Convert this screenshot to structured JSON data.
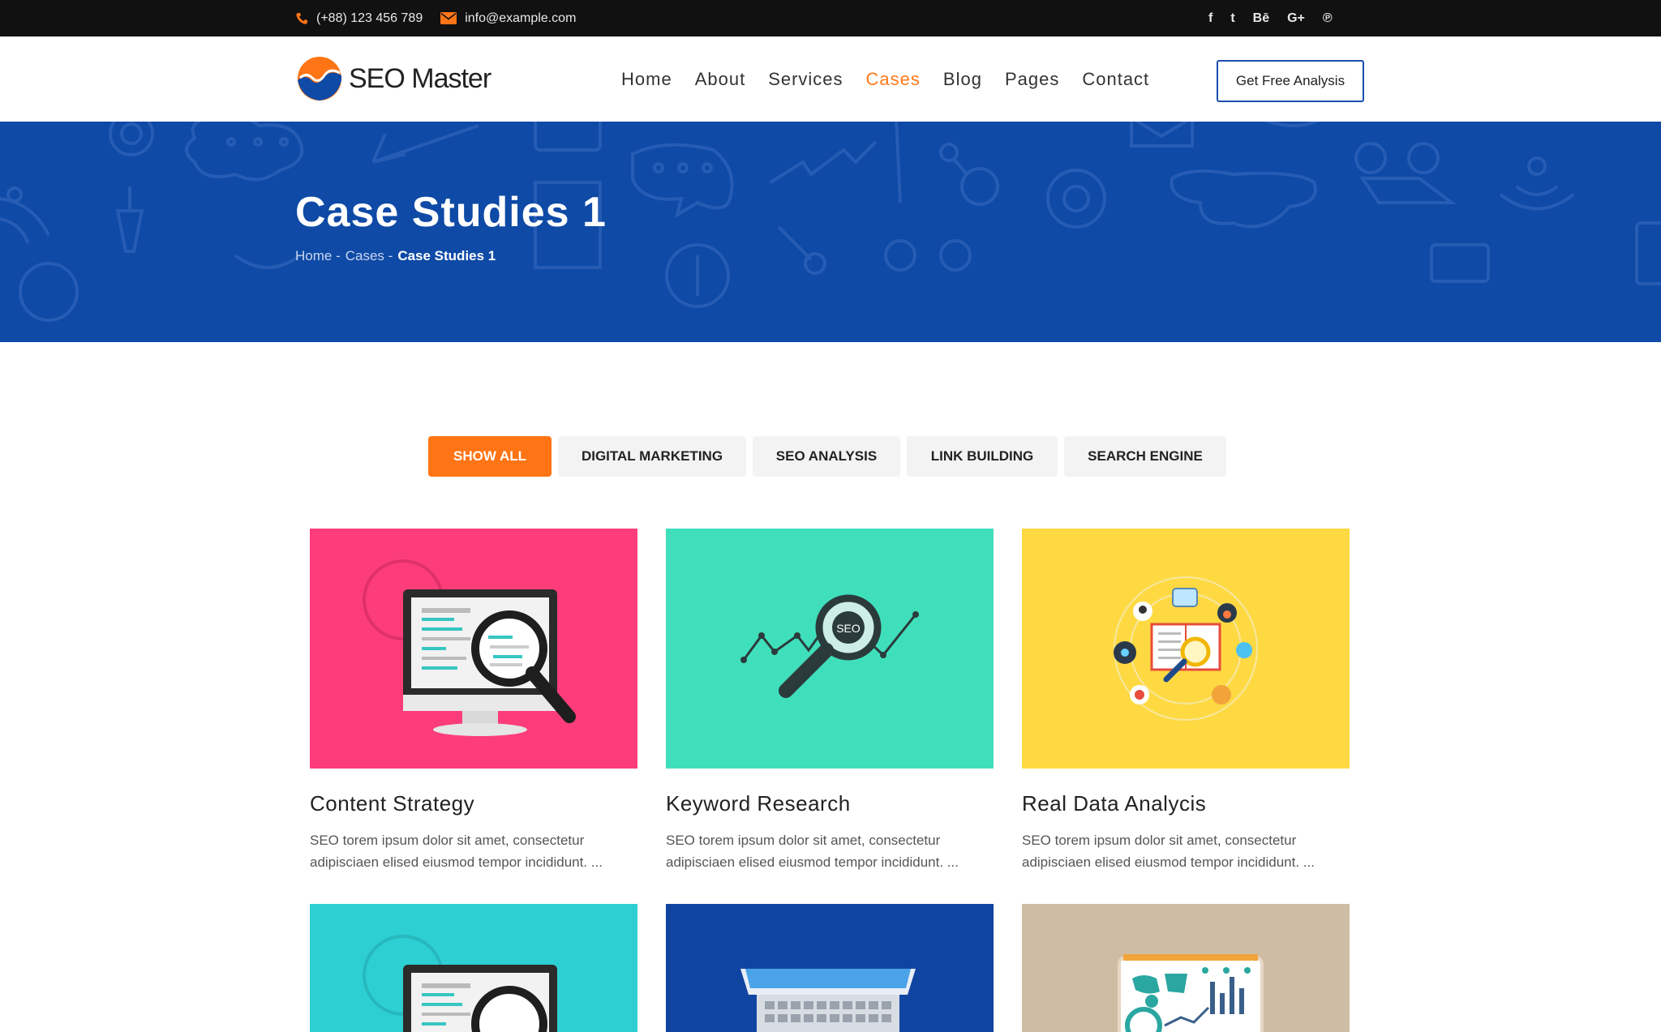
{
  "topbar": {
    "phone": "(+88) 123 456 789",
    "email": "info@example.com",
    "social": [
      {
        "icon": "facebook-icon",
        "glyph": "f"
      },
      {
        "icon": "twitter-icon",
        "glyph": "t"
      },
      {
        "icon": "behance-icon",
        "glyph": "Bē"
      },
      {
        "icon": "google-plus-icon",
        "glyph": "G+"
      },
      {
        "icon": "pinterest-icon",
        "glyph": "℗"
      }
    ]
  },
  "header": {
    "brand": "SEO Master",
    "nav": [
      "Home",
      "About",
      "Services",
      "Cases",
      "Blog",
      "Pages",
      "Contact"
    ],
    "active_nav": "Cases",
    "cta": "Get Free Analysis"
  },
  "hero": {
    "title": "Case Studies 1",
    "breadcrumb": [
      "Home -",
      "Cases -",
      "Case Studies 1"
    ]
  },
  "filters": [
    "Show All",
    "Digital Marketing",
    "SEO Analysis",
    "Link Building",
    "Search Engine"
  ],
  "active_filter": "Show All",
  "cards": [
    {
      "title": "Content Strategy",
      "desc_line1": "SEO torem ipsum dolor sit amet, consectetur",
      "desc_line2": "adipisciaen elised eiusmod tempor incididunt. ...",
      "bg": "#fc3d7a"
    },
    {
      "title": "Keyword Research",
      "desc_line1": "SEO torem ipsum dolor sit amet, consectetur",
      "desc_line2": "adipisciaen elised eiusmod tempor incididunt. ...",
      "bg": "#40dfbc",
      "badge": "SEO"
    },
    {
      "title": "Real Data Analycis",
      "desc_line1": "SEO torem ipsum dolor sit amet, consectetur",
      "desc_line2": "adipisciaen elised eiusmod tempor incididunt. ...",
      "bg": "#fed942"
    },
    {
      "bg": "#2ecfd3"
    },
    {
      "bg": "#0f45a0"
    },
    {
      "bg": "#cfbca4"
    }
  ],
  "colors": {
    "accent": "#ff7415",
    "brand_blue": "#0e4aa6",
    "topbar": "#111111"
  }
}
